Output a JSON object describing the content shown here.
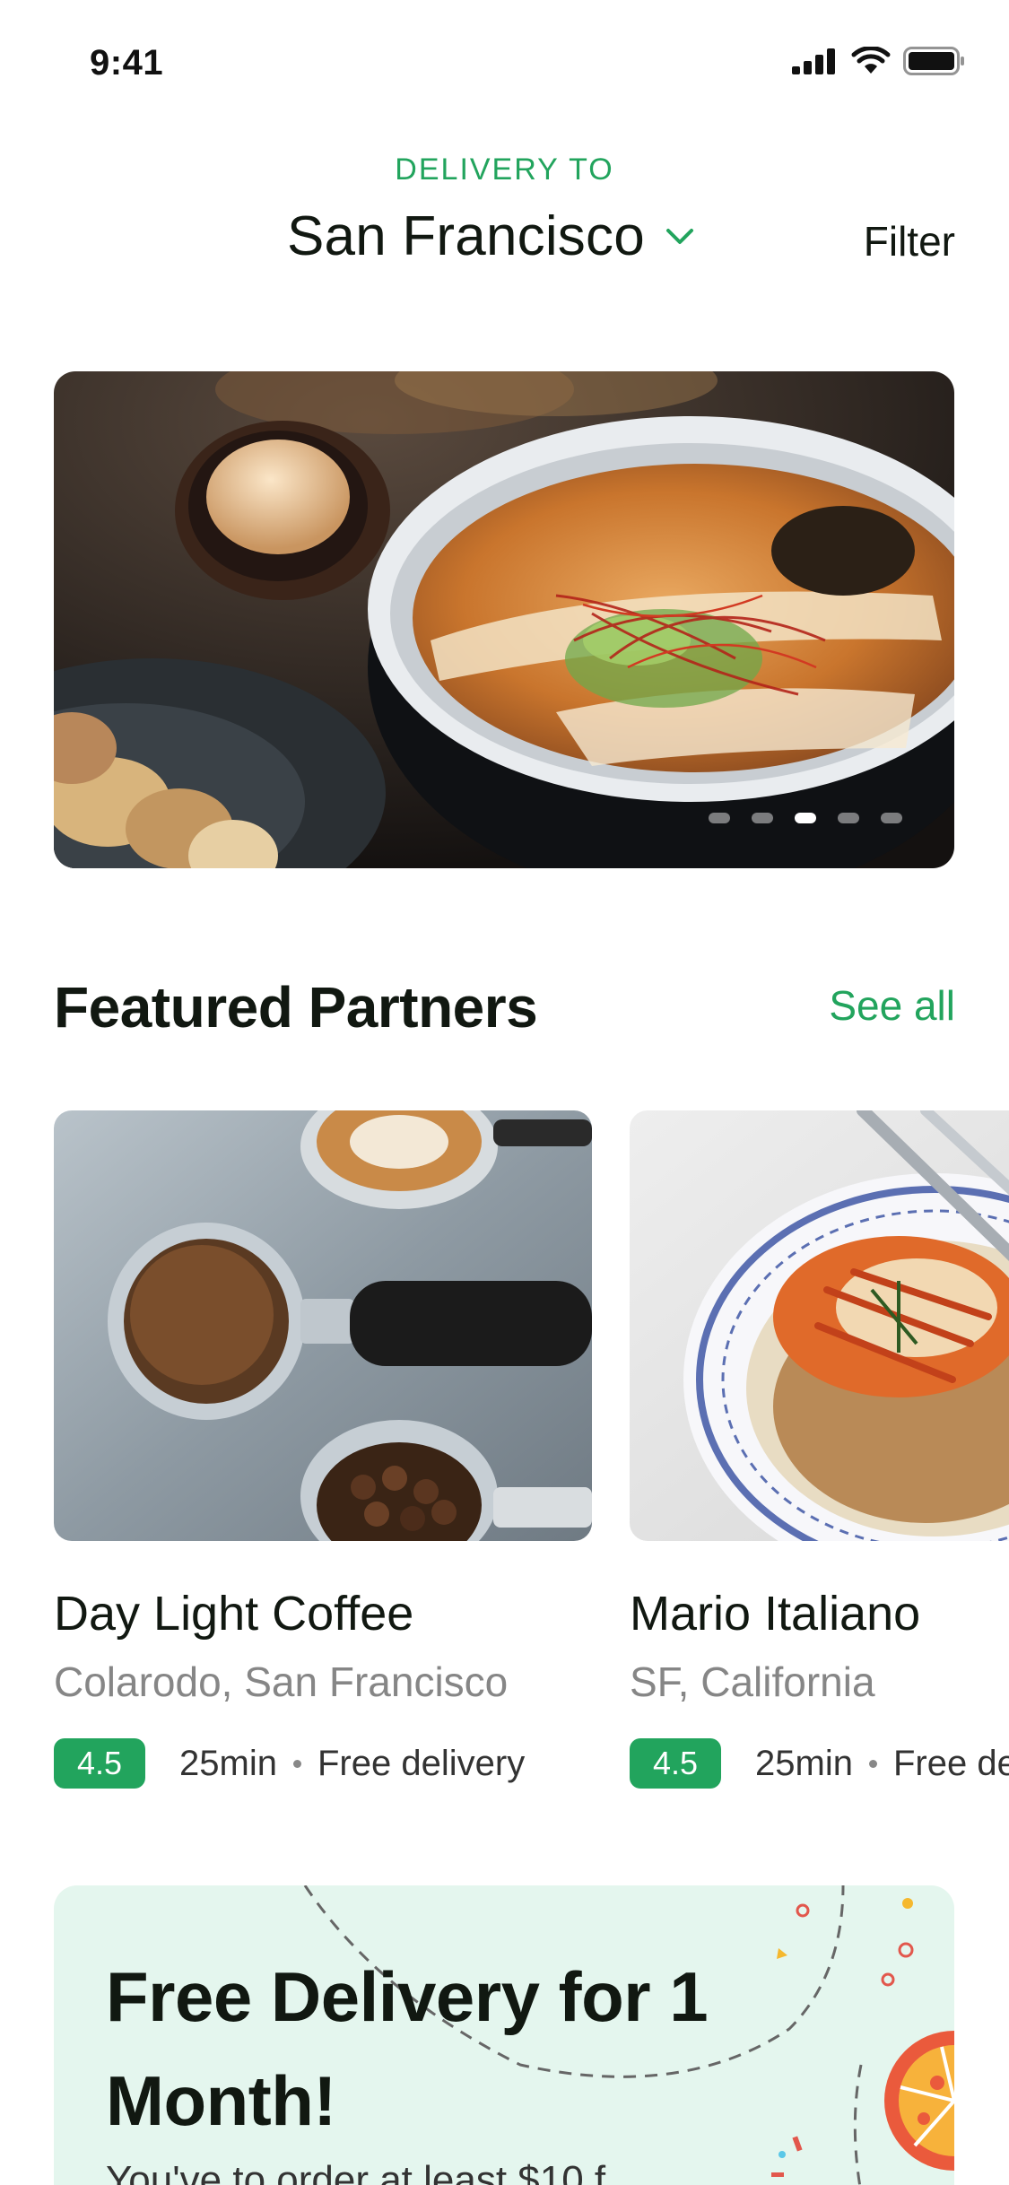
{
  "status_bar": {
    "time": "9:41"
  },
  "header": {
    "delivery_label": "DELIVERY TO",
    "location": "San Francisco",
    "filter_label": "Filter"
  },
  "hero": {
    "dots": 5,
    "active_dot": 3
  },
  "featured": {
    "title": "Featured Partners",
    "see_all": "See all",
    "cards": [
      {
        "name": "Day Light Coffee",
        "location": "Colarodo, San Francisco",
        "rating": "4.5",
        "time": "25min",
        "delivery": "Free delivery"
      },
      {
        "name": "Mario Italiano",
        "location": "SF, California",
        "rating": "4.5",
        "time": "25min",
        "delivery": "Free delivery"
      }
    ]
  },
  "promo": {
    "title": "Free Delivery for 1 Month!",
    "subtitle": "You've to order at least $10 f"
  },
  "colors": {
    "accent": "#22a45d",
    "promo_bg": "#e4f6ee",
    "text": "#111811",
    "muted": "#868686"
  }
}
